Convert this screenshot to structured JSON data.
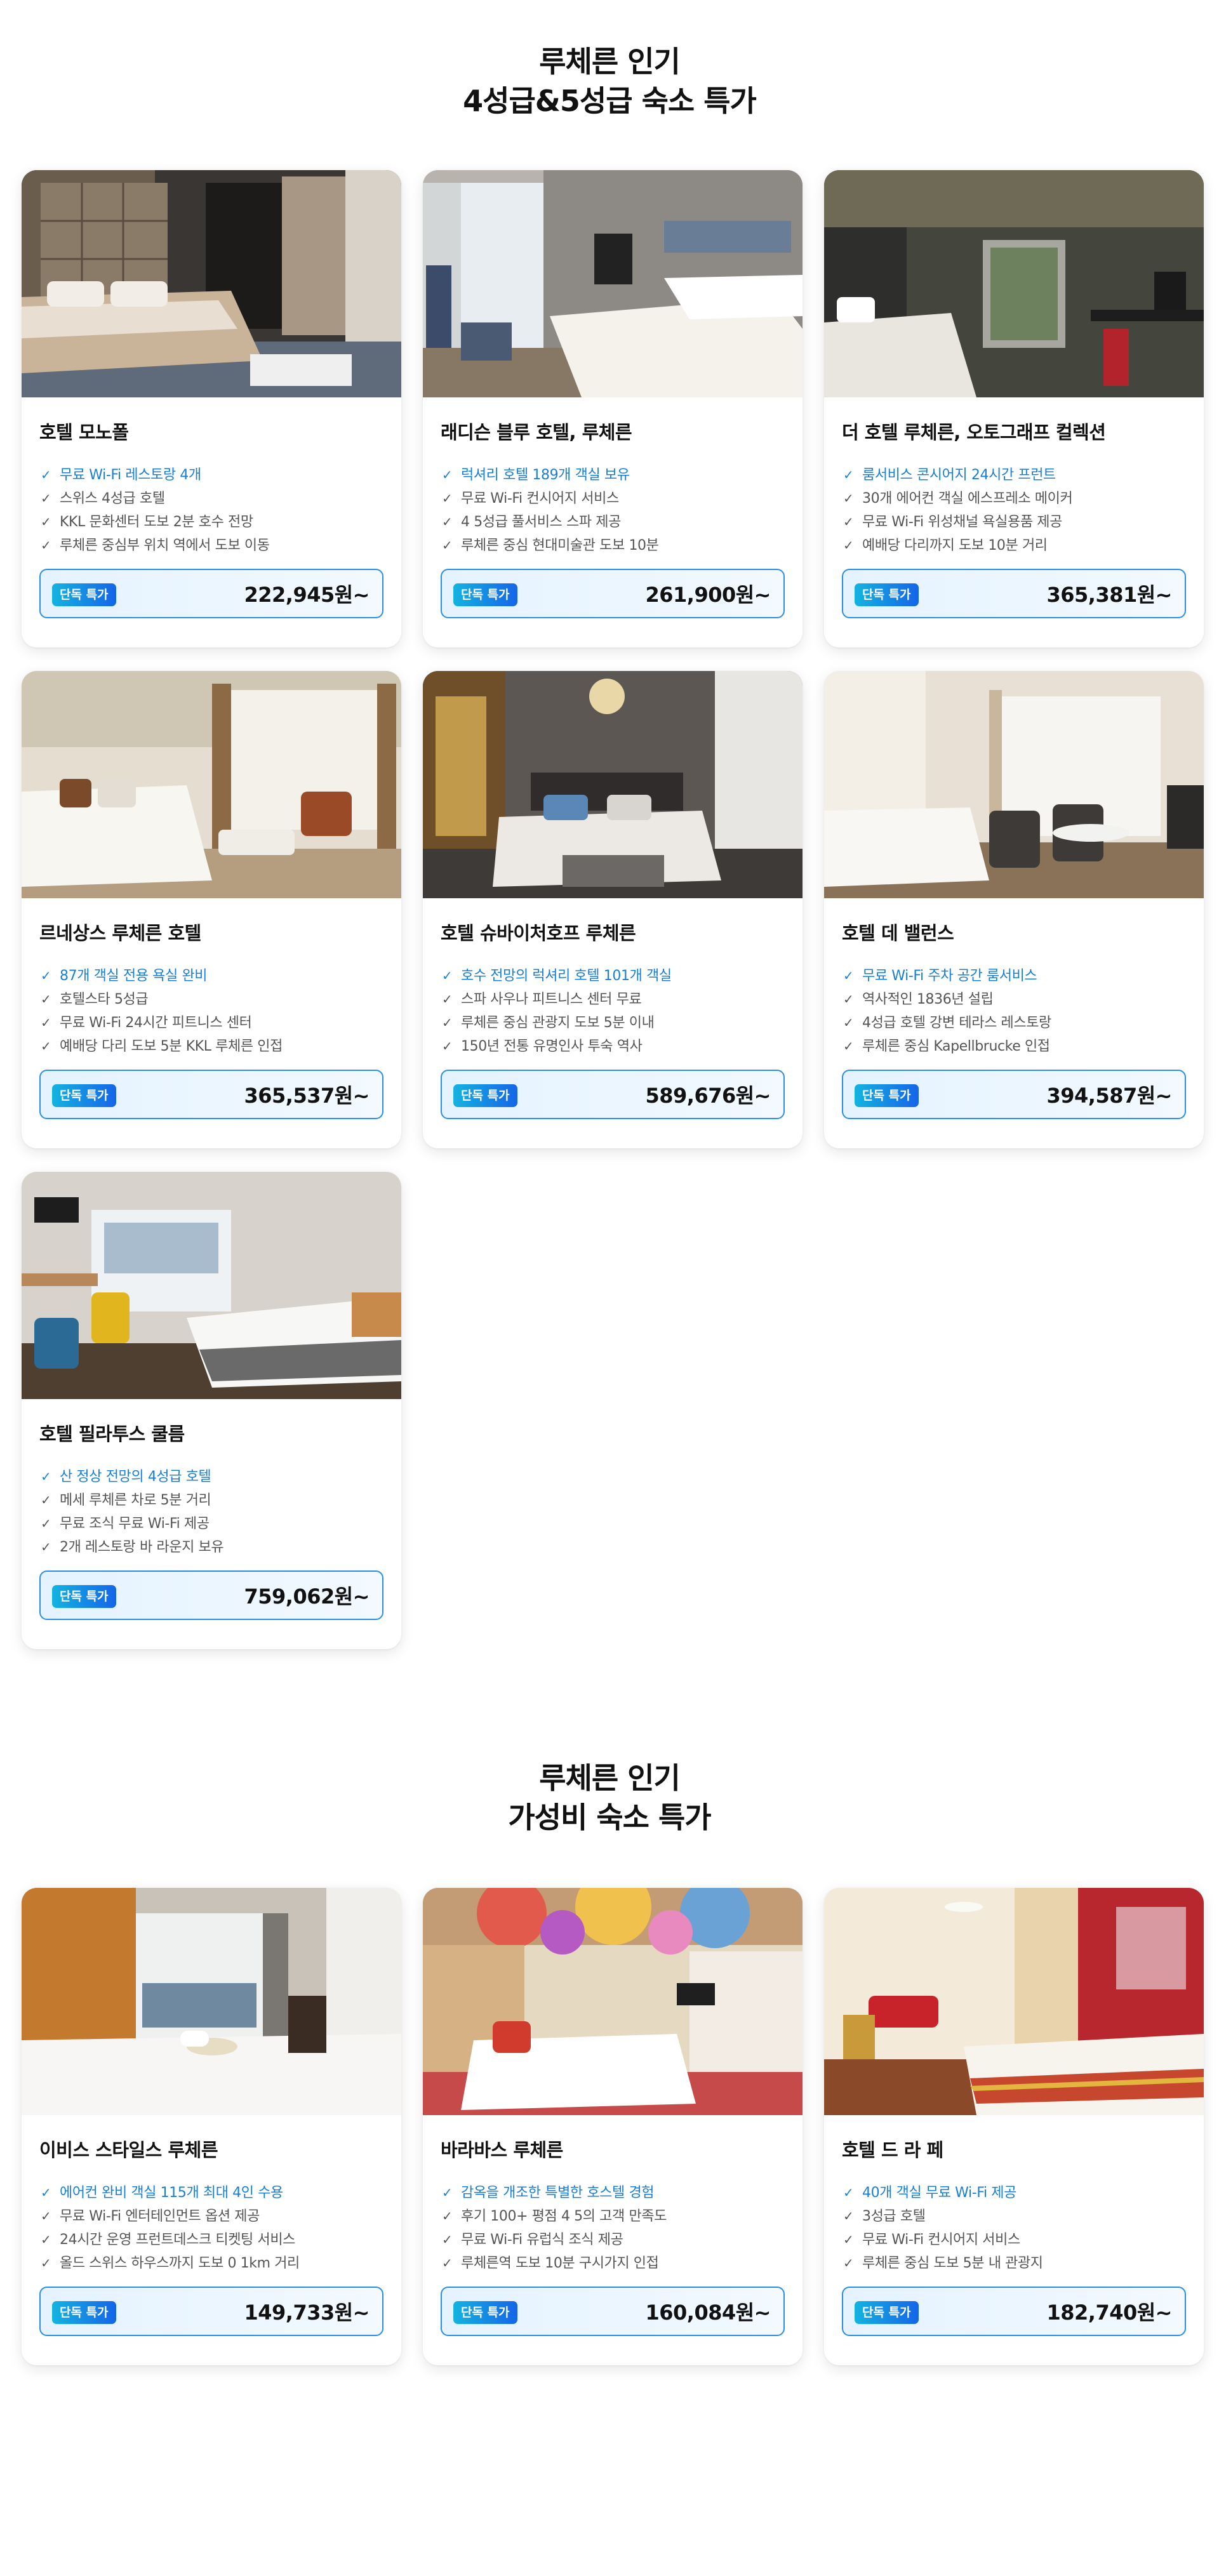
{
  "sections": [
    {
      "title_line1": "루체른 인기",
      "title_line2": "4성급&5성급 숙소 특가",
      "hotels": [
        {
          "name": "호텔 모노폴",
          "features": [
            "무료 Wi-Fi 레스토랑 4개",
            "스위스 4성급 호텔",
            "KKL 문화센터 도보 2분 호수 전망",
            "루체른 중심부 위치 역에서 도보 이동"
          ],
          "badge": "단독 특가",
          "price": "222,945원~"
        },
        {
          "name": "래디슨 블루 호텔, 루체른",
          "features": [
            "럭셔리 호텔 189개 객실 보유",
            "무료 Wi-Fi 컨시어지 서비스",
            "4 5성급 풀서비스 스파 제공",
            "루체른 중심 현대미술관 도보 10분"
          ],
          "badge": "단독 특가",
          "price": "261,900원~"
        },
        {
          "name": "더 호텔 루체른, 오토그래프 컬렉션",
          "features": [
            "룸서비스 콘시어지 24시간 프런트",
            "30개 에어컨 객실 에스프레소 메이커",
            "무료 Wi-Fi 위성채널 욕실용품 제공",
            "예배당 다리까지 도보 10분 거리"
          ],
          "badge": "단독 특가",
          "price": "365,381원~"
        },
        {
          "name": "르네상스 루체른 호텔",
          "features": [
            "87개 객실 전용 욕실 완비",
            "호텔스타 5성급",
            "무료 Wi-Fi 24시간 피트니스 센터",
            "예배당 다리 도보 5분 KKL 루체른 인접"
          ],
          "badge": "단독 특가",
          "price": "365,537원~"
        },
        {
          "name": "호텔 슈바이처호프 루체른",
          "features": [
            "호수 전망의 럭셔리 호텔 101개 객실",
            "스파 사우나 피트니스 센터 무료",
            "루체른 중심 관광지 도보 5분 이내",
            "150년 전통 유명인사 투숙 역사"
          ],
          "badge": "단독 특가",
          "price": "589,676원~"
        },
        {
          "name": "호텔 데 밸런스",
          "features": [
            "무료 Wi-Fi 주차 공간 룸서비스",
            "역사적인 1836년 설립",
            "4성급 호텔 강변 테라스 레스토랑",
            "루체른 중심 Kapellbrucke 인접"
          ],
          "badge": "단독 특가",
          "price": "394,587원~"
        },
        {
          "name": "호텔 필라투스 쿨름",
          "features": [
            "산 정상 전망의 4성급 호텔",
            "메세 루체른 차로 5분 거리",
            "무료 조식 무료 Wi-Fi 제공",
            "2개 레스토랑 바 라운지 보유"
          ],
          "badge": "단독 특가",
          "price": "759,062원~"
        }
      ]
    },
    {
      "title_line1": "루체른 인기",
      "title_line2": "가성비 숙소 특가",
      "hotels": [
        {
          "name": "이비스 스타일스 루체른",
          "features": [
            "에어컨 완비 객실 115개 최대 4인 수용",
            "무료 Wi-Fi 엔터테인먼트 옵션 제공",
            "24시간 운영 프런트데스크 티켓팅 서비스",
            "올드 스위스 하우스까지 도보 0 1km 거리"
          ],
          "badge": "단독 특가",
          "price": "149,733원~"
        },
        {
          "name": "바라바스 루체른",
          "features": [
            "감옥을 개조한 특별한 호스텔 경험",
            "후기 100+ 평점 4 5의 고객 만족도",
            "무료 Wi-Fi 유럽식 조식 제공",
            "루체른역 도보 10분 구시가지 인접"
          ],
          "badge": "단독 특가",
          "price": "160,084원~"
        },
        {
          "name": "호텔 드 라 페",
          "features": [
            "40개 객실 무료 Wi-Fi 제공",
            "3성급 호텔",
            "무료 Wi-Fi 컨시어지 서비스",
            "루체른 중심 도보 5분 내 관광지"
          ],
          "badge": "단독 특가",
          "price": "182,740원~"
        }
      ]
    }
  ],
  "colors": {
    "accent": "#1a7fd4",
    "feature_text": "#555555",
    "deal_border": "#2a8ee6",
    "badge_start": "#14b3e0",
    "badge_end": "#1565e8"
  },
  "icons": {
    "feature_bullet": "check-icon"
  }
}
